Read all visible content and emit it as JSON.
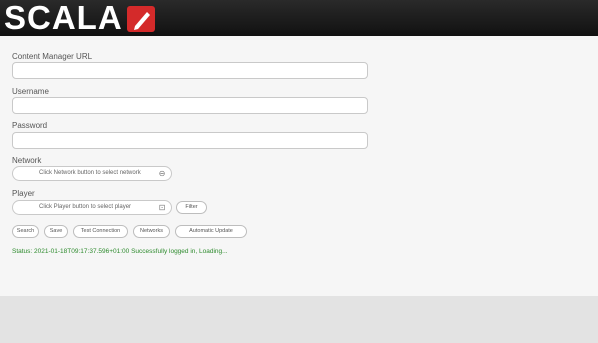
{
  "app": {
    "logo_text": "SCALA",
    "brand_color": "#d42a2a",
    "header_color": "#1a1a1a"
  },
  "form": {
    "fields": [
      {
        "label": "Content Manager URL",
        "value": ""
      },
      {
        "label": "Username",
        "value": ""
      },
      {
        "label": "Password",
        "value": ""
      }
    ],
    "network": {
      "label": "Network",
      "selected": "Click Network button to select network"
    },
    "player": {
      "label": "Player",
      "selected": "Click Player button to select player",
      "filter_label": "Filter"
    }
  },
  "actions": [
    {
      "label": "Search"
    },
    {
      "label": "Save"
    },
    {
      "label": "Test Connection"
    },
    {
      "label": "Networks"
    },
    {
      "label": "Automatic Update"
    }
  ],
  "status": {
    "text": "Status: 2021-01-18T09:17:37.596+01:00 Successfully logged in, Loading...",
    "color": "#2e8b2e"
  }
}
